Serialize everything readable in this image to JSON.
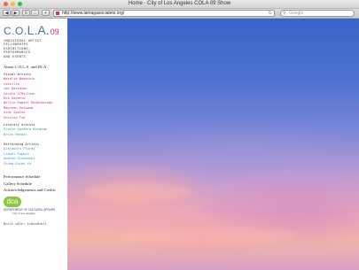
{
  "browser": {
    "title": "Home · City of Los Angeles COLA 09 Show",
    "url": "http://www.lamagasocialets.org/",
    "search_placeholder": "Google",
    "traffic_colors": [
      "#ff5f57",
      "#febc2e",
      "#28c840"
    ]
  },
  "logo": {
    "co": "C.O.",
    "la": "L.A.",
    "num": "09"
  },
  "tagline": {
    "line1": "INDIVIDUAL ARTIST",
    "line2": "FELLOWSHIPS",
    "line3": "EXHIBITIONS,",
    "line4": "PERFORMANCES",
    "line5": "AND EVENTS"
  },
  "about_link": "About C.O.L.A. and DCA",
  "visual": {
    "heading": "Visual Artists",
    "color": "#e0267a",
    "items": [
      "Natalie Bookchin",
      "Castillo",
      "Joe Davidson",
      "Carole CCMillain",
      "Bia Gayotto",
      "Willie Robert Middlebrook",
      "Maureen Selwood",
      "Vinz Sosine",
      "Shirley Tse"
    ]
  },
  "literary": {
    "heading": "Literary Artists",
    "color": "#3aa57a",
    "items": [
      "Glorie Gaudara Bingnam",
      "Brice Hendel"
    ]
  },
  "performing": {
    "heading": "Performing Artists",
    "color": "#3a8fd6",
    "items": [
      "Alejandra Flores",
      "Lionel Popkin",
      "Andrew Stukowski",
      "Chung-Chiek Yu"
    ]
  },
  "links": {
    "performance": "Performance Schedule",
    "gallery": "Gallery Schedule",
    "ack": "Acknowledgements and Credits"
  },
  "dca": {
    "mark": "dca",
    "line1": "DEPARTMENT OF CULTURAL AFFAIRS",
    "line2": "City of Los Angeles"
  },
  "built": "Built with: IndexHibit"
}
